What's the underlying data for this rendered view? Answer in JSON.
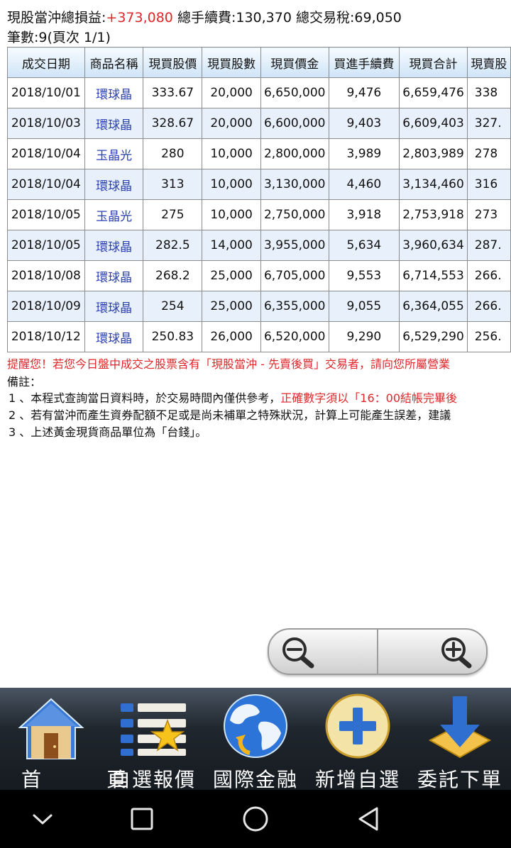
{
  "summary": {
    "pnl_label": "現股當沖總損益:",
    "pnl_value": "+373,080",
    "fee_label": " 總手續費:",
    "fee_value": "130,370",
    "tax_label": " 總交易稅:",
    "tax_value": "69,050",
    "pages": "筆數:9(頁次 1/1)"
  },
  "table": {
    "headers": [
      "成交日期",
      "商品名稱",
      "現買股價",
      "現買股數",
      "現買價金",
      "買進手續費",
      "現買合計",
      "現賣股"
    ],
    "rows": [
      [
        "2018/10/01",
        "環球晶",
        "333.67",
        "20,000",
        "6,650,000",
        "9,476",
        "6,659,476",
        "338"
      ],
      [
        "2018/10/03",
        "環球晶",
        "328.67",
        "20,000",
        "6,600,000",
        "9,403",
        "6,609,403",
        "327."
      ],
      [
        "2018/10/04",
        "玉晶光",
        "280",
        "10,000",
        "2,800,000",
        "3,989",
        "2,803,989",
        "278"
      ],
      [
        "2018/10/04",
        "環球晶",
        "313",
        "10,000",
        "3,130,000",
        "4,460",
        "3,134,460",
        "316"
      ],
      [
        "2018/10/05",
        "玉晶光",
        "275",
        "10,000",
        "2,750,000",
        "3,918",
        "2,753,918",
        "273"
      ],
      [
        "2018/10/05",
        "環球晶",
        "282.5",
        "14,000",
        "3,955,000",
        "5,634",
        "3,960,634",
        "287."
      ],
      [
        "2018/10/08",
        "環球晶",
        "268.2",
        "25,000",
        "6,705,000",
        "9,553",
        "6,714,553",
        "266."
      ],
      [
        "2018/10/09",
        "環球晶",
        "254",
        "25,000",
        "6,355,000",
        "9,055",
        "6,364,055",
        "266."
      ],
      [
        "2018/10/12",
        "環球晶",
        "250.83",
        "26,000",
        "6,520,000",
        "9,290",
        "6,529,290",
        "256."
      ]
    ]
  },
  "notes": {
    "warning": "提醒您！若您今日盤中成交之股票含有「現股當沖 - 先賣後買」交易者，請向您所屬營業",
    "title": "備註：",
    "note1_text": "1 、本程式查詢當日資料時，於交易時間內僅供參考，",
    "note1_red": "正確數字須以「16：00結帳完畢後",
    "note2": "2 、若有當沖而產生資券配額不足或是尚未補單之特殊狀況，計算上可能產生誤差，建議",
    "note3": "3 、上述黃金現貨商品單位為「台錢」。"
  },
  "zoom": {
    "out_icon": "zoom-out-icon",
    "in_icon": "zoom-in-icon"
  },
  "nav": {
    "items": [
      {
        "label": "首　頁",
        "icon": "home-icon"
      },
      {
        "label": "自選報價",
        "icon": "watchlist-icon"
      },
      {
        "label": "國際金融",
        "icon": "globe-icon"
      },
      {
        "label": "新增自選",
        "icon": "add-icon"
      },
      {
        "label": "委託下單",
        "icon": "order-arrow-icon"
      }
    ]
  },
  "system_bar": {
    "icons": [
      "chevron-down-icon",
      "recent-apps-icon",
      "home-circle-icon",
      "back-icon"
    ]
  },
  "colors": {
    "accent_red": "#e0262a",
    "link_blue": "#2b3fb5",
    "header_blue": "#cfe4f7",
    "nav_bg": "#1f262d"
  }
}
